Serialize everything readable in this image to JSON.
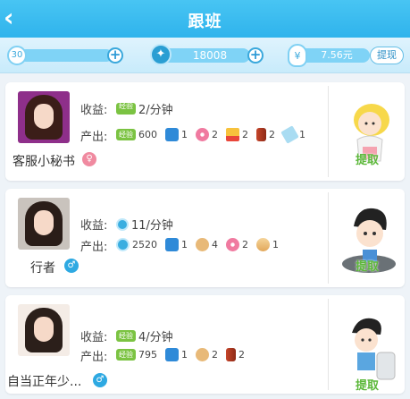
{
  "header": {
    "title": "跟班",
    "back_icon": "back-arrow-icon"
  },
  "stats": {
    "level": "30",
    "coins": "18008",
    "money": "7.56元",
    "withdraw_label": "提现"
  },
  "labels": {
    "income": "收益:",
    "output": "产出:",
    "withdraw": "提取"
  },
  "colors": {
    "header": "#2fb3ec",
    "accent": "#2ea9e2",
    "exp_badge": "#7bc342"
  },
  "cards": [
    {
      "name": "客服小秘书",
      "gender": "female",
      "income_icon": "exp-badge-icon",
      "income_value": "2/分钟",
      "outputs": [
        {
          "icon": "exp-badge-icon",
          "count": "600"
        },
        {
          "icon": "ticket-icon",
          "count": "1"
        },
        {
          "icon": "donut-icon",
          "count": "2"
        },
        {
          "icon": "fries-icon",
          "count": "2"
        },
        {
          "icon": "cola-icon",
          "count": "2"
        },
        {
          "icon": "ice-pop-icon",
          "count": "1"
        }
      ]
    },
    {
      "name": "行者",
      "gender": "male",
      "income_icon": "coin-icon",
      "income_value": "11/分钟",
      "outputs": [
        {
          "icon": "coin-icon",
          "count": "2520"
        },
        {
          "icon": "ticket-icon",
          "count": "1"
        },
        {
          "icon": "bread-icon",
          "count": "4"
        },
        {
          "icon": "donut-icon",
          "count": "2"
        },
        {
          "icon": "taco-icon",
          "count": "1"
        }
      ]
    },
    {
      "name": "自当正年少...",
      "gender": "male",
      "income_icon": "exp-badge-icon",
      "income_value": "4/分钟",
      "outputs": [
        {
          "icon": "exp-badge-icon",
          "count": "795"
        },
        {
          "icon": "ticket-icon",
          "count": "1"
        },
        {
          "icon": "bread-icon",
          "count": "2"
        },
        {
          "icon": "cola-icon",
          "count": "2"
        }
      ]
    }
  ]
}
